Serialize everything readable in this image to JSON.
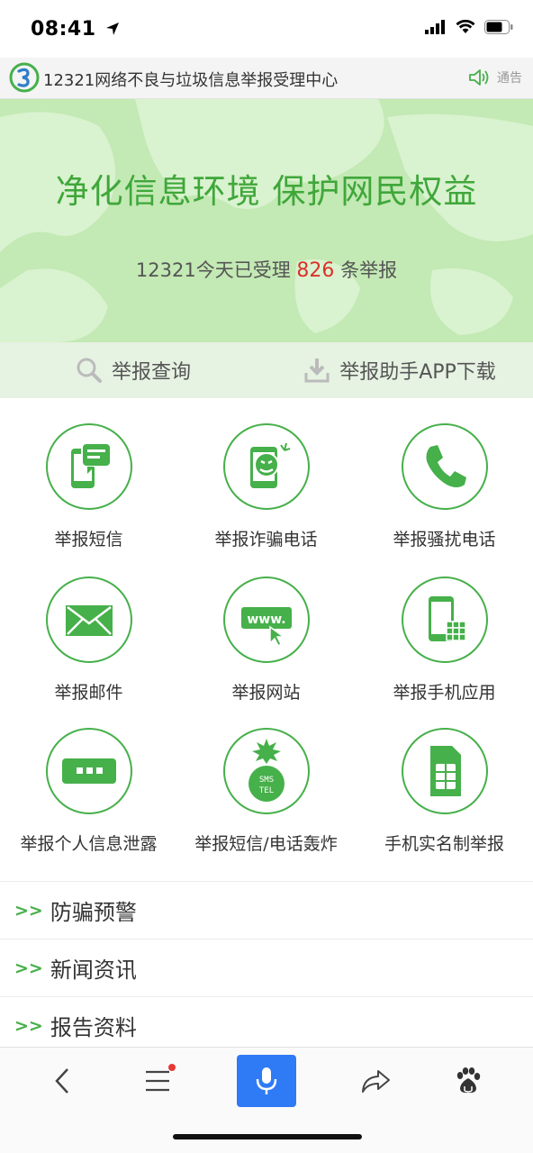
{
  "status": {
    "time": "08:41",
    "icons": [
      "location-arrow-icon",
      "cellular-signal-icon",
      "wifi-icon",
      "battery-icon"
    ]
  },
  "header": {
    "title": "12321网络不良与垃圾信息举报受理中心",
    "notice_label": "通告"
  },
  "banner": {
    "slogan": "净化信息环境 保护网民权益",
    "counter_prefix": "12321今天已受理",
    "counter_value": "826",
    "counter_suffix": "条举报"
  },
  "actions": {
    "query": "举报查询",
    "download": "举报助手APP下载"
  },
  "grid": [
    {
      "label": "举报短信",
      "icon": "sms-phone-icon"
    },
    {
      "label": "举报诈骗电话",
      "icon": "fraud-phone-icon"
    },
    {
      "label": "举报骚扰电话",
      "icon": "handset-icon"
    },
    {
      "label": "举报邮件",
      "icon": "envelope-icon"
    },
    {
      "label": "举报网站",
      "icon": "www-cursor-icon"
    },
    {
      "label": "举报手机应用",
      "icon": "mobile-app-icon"
    },
    {
      "label": "举报个人信息泄露",
      "icon": "chat-dots-icon"
    },
    {
      "label": "举报短信/电话轰炸",
      "icon": "sms-tel-bomb-icon"
    },
    {
      "label": "手机实名制举报",
      "icon": "sim-card-icon"
    }
  ],
  "links": {
    "arrow": ">>",
    "items": [
      "防骗预警",
      "新闻资讯",
      "报告资料"
    ]
  },
  "colors": {
    "brand_green": "#46b04a",
    "counter_red": "#d9332b",
    "voice_blue": "#2f7af5"
  }
}
